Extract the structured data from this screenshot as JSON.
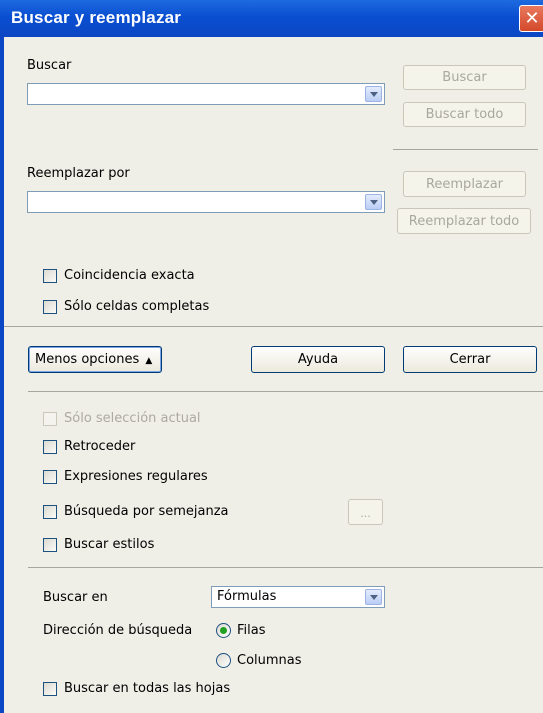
{
  "window": {
    "title": "Buscar y reemplazar",
    "close_glyph": "✕"
  },
  "search": {
    "label": "Buscar",
    "value": "",
    "buscar_button": "Buscar",
    "buscar_todo_button": "Buscar todo"
  },
  "replace": {
    "label": "Reemplazar por",
    "value": "",
    "reemplazar_button": "Reemplazar",
    "reemplazar_todo_button": "Reemplazar todo"
  },
  "options": {
    "match_case": "Coincidencia exacta",
    "whole_cells": "Sólo celdas completas"
  },
  "buttons": {
    "less_options": "Menos opciones",
    "help": "Ayuda",
    "close": "Cerrar"
  },
  "more_options": {
    "current_selection": "Sólo selección actual",
    "backwards": "Retroceder",
    "regex": "Expresiones regulares",
    "similarity": "Búsqueda por semejanza",
    "similarity_button": "...",
    "styles": "Buscar estilos"
  },
  "search_in": {
    "label": "Buscar en",
    "value": "Fórmulas"
  },
  "direction": {
    "label": "Dirección de búsqueda",
    "rows": "Filas",
    "columns": "Columnas"
  },
  "all_sheets": "Buscar en todas las hojas",
  "icons": {
    "close": "close-icon",
    "combo_arrow": "chevron-down-icon",
    "toggle": "up-arrows-icon"
  }
}
